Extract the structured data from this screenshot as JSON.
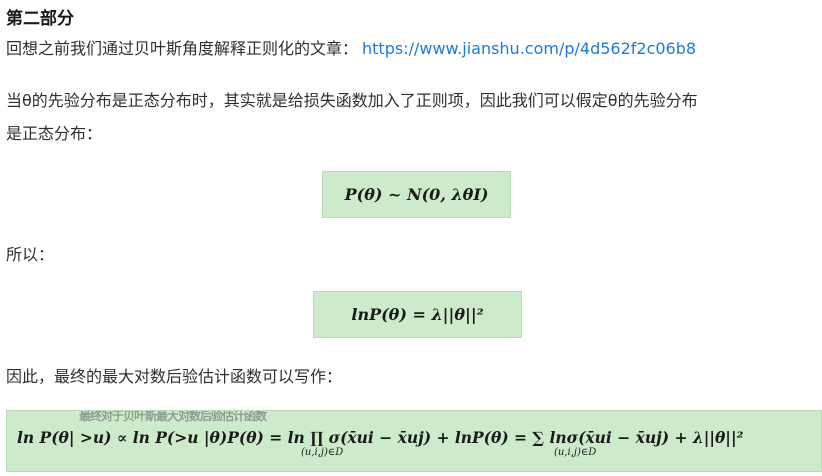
{
  "section_title": "第二部分",
  "recall": {
    "text": "回想之前我们通过贝叶斯角度解释正则化的文章：",
    "link": "https://www.jianshu.com/p/4d562f2c06b8"
  },
  "prior_line_1": "当θ的先验分布是正态分布时，其实就是给损失函数加入了正则项，因此我们可以假定θ的先验分布",
  "prior_line_2": "是正态分布：",
  "formula_prior": "P(θ) ~ N(0, λθI)",
  "so_text": "所以：",
  "formula_log_prior": "lnP(θ) = λ||θ||²",
  "final_text": "因此，最终的最大对数后验估计函数可以写作：",
  "formula_final": {
    "ghost_text": "最终对于贝叶斯最大对数后验估计函数",
    "expr": "ln P(θ| >u) ∝ ln P(>u |θ)P(θ) = ln ∏ σ(x̄ui − x̄uj) + lnP(θ) = ∑ lnσ(x̄ui − x̄uj) + λ||θ||²",
    "prod_subscript": "(u,i,j)∈D",
    "sum_subscript": "(u,i,j)∈D"
  }
}
